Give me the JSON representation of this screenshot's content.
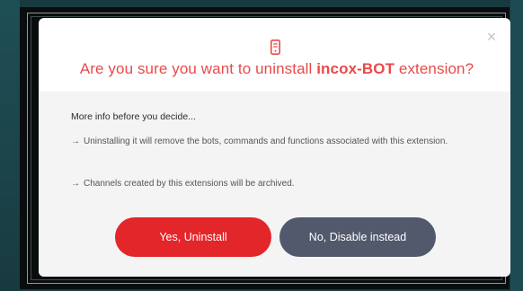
{
  "dialog": {
    "title_prefix": "Are you sure you want to uninstall ",
    "title_name": "incox-BOT",
    "title_suffix": " extension?",
    "close_glyph": "×",
    "icon": "mobile-phone-icon",
    "info_heading": "More info before you decide...",
    "info_items": [
      {
        "arrow": "→",
        "text": "Uninstalling it will remove the bots, commands and functions associated with this extension."
      },
      {
        "arrow": "→",
        "text": "Channels created by this extensions will be archived."
      }
    ],
    "confirm_label": "Yes, Uninstall",
    "alt_label": "No, Disable instead"
  },
  "colors": {
    "accent_red": "#e84a4a",
    "confirm_button": "#e3262a",
    "alt_button": "#52596c",
    "body_bg": "#f4f4f5"
  }
}
